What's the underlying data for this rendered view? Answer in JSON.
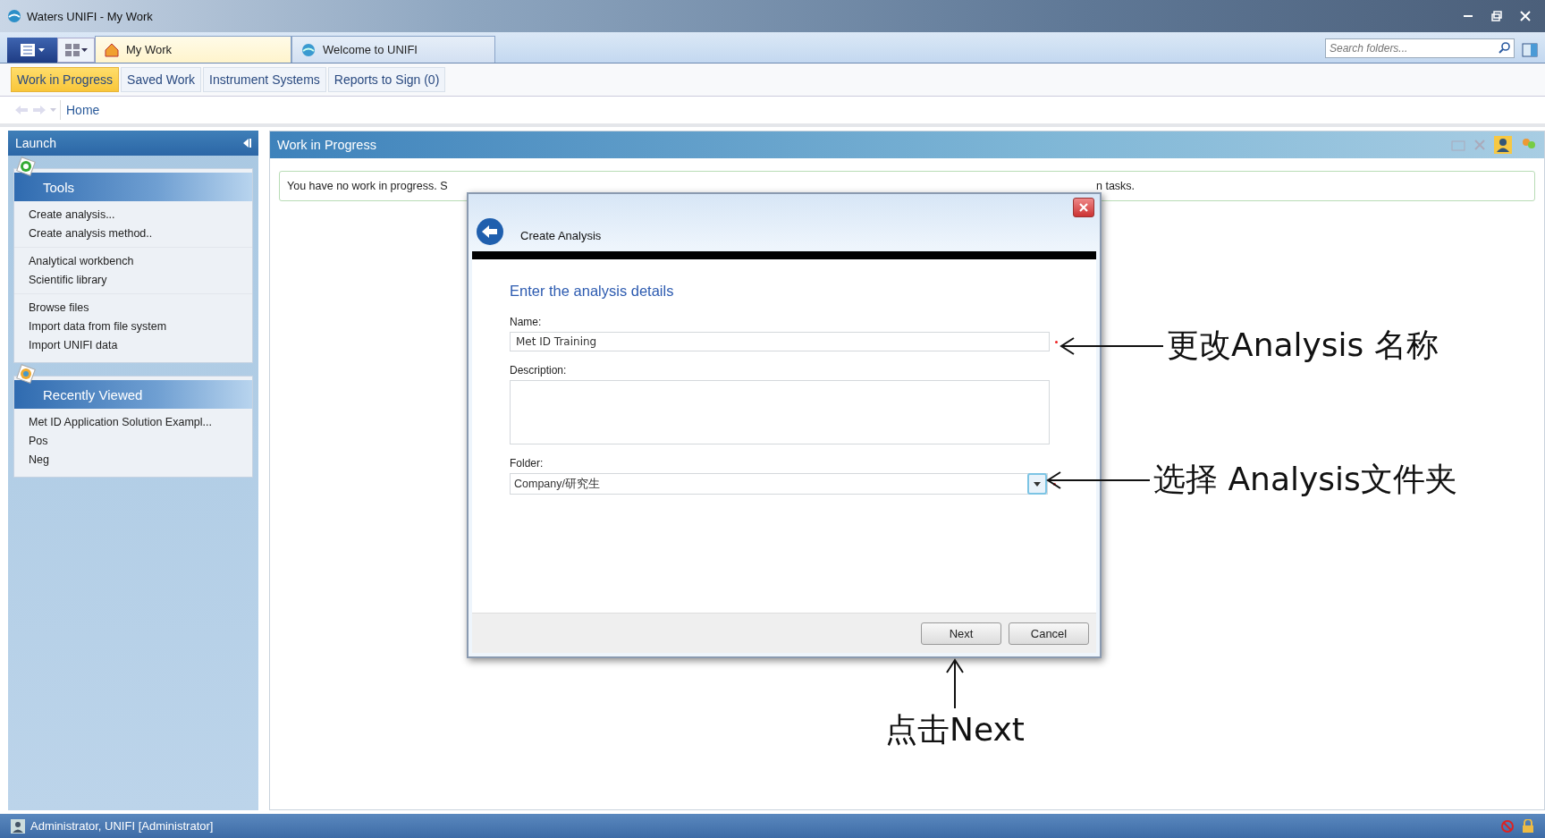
{
  "window": {
    "title": "Waters UNIFI - My Work"
  },
  "doc_tabs": [
    {
      "label": "My Work",
      "selected": true
    },
    {
      "label": "Welcome to UNIFI",
      "selected": false
    }
  ],
  "search": {
    "placeholder": "Search folders..."
  },
  "nav_tabs": [
    {
      "label": "Work in Progress",
      "selected": true
    },
    {
      "label": "Saved Work",
      "selected": false
    },
    {
      "label": "Instrument Systems",
      "selected": false
    },
    {
      "label": "Reports to Sign (0)",
      "selected": false
    }
  ],
  "breadcrumb": "Home",
  "launch": {
    "title": "Launch",
    "sections": [
      {
        "title": "Tools",
        "groups": [
          [
            "Create analysis...",
            "Create analysis method.."
          ],
          [
            "Analytical workbench",
            "Scientific library"
          ],
          [
            "Browse files",
            "Import data from file system",
            "Import UNIFI data"
          ]
        ]
      },
      {
        "title": "Recently Viewed",
        "groups": [
          [
            "Met ID Application Solution Exampl...",
            "Pos",
            "Neg"
          ]
        ]
      }
    ]
  },
  "main": {
    "title": "Work in Progress",
    "message_parts": [
      "You have no work in progress. S",
      "n tasks."
    ]
  },
  "dialog": {
    "title": "Create Analysis",
    "heading": "Enter the analysis details",
    "fields": [
      {
        "kind": "text",
        "label": "Name:",
        "value": "Met ID Training",
        "required": true
      },
      {
        "kind": "textarea",
        "label": "Description:"
      },
      {
        "kind": "dropdown",
        "label": "Folder:",
        "value": "Company/研究生",
        "required": true
      }
    ],
    "buttons": [
      "Next",
      "Cancel"
    ]
  },
  "annotations": [
    {
      "kind": "left-arrow",
      "text": "更改Analysis 名称"
    },
    {
      "kind": "left-arrow",
      "text": "选择 Analysis文件夹"
    },
    {
      "kind": "up-arrow",
      "text": "点击Next"
    }
  ],
  "status_bar": {
    "user": "Administrator, UNIFI [Administrator]"
  }
}
